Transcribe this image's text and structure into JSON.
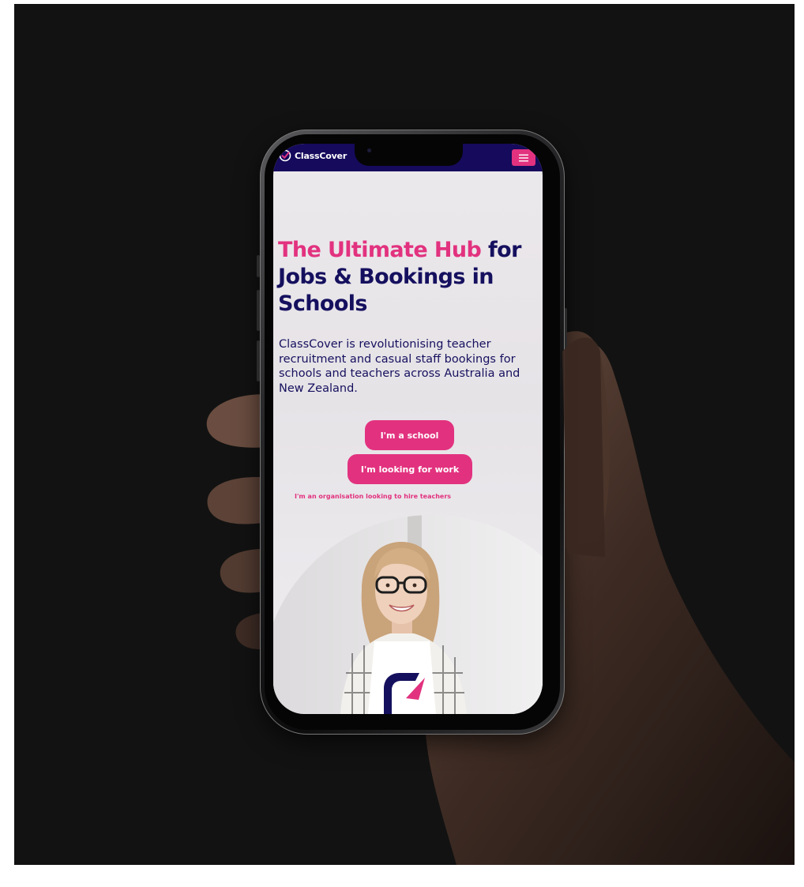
{
  "brand": {
    "logo_text": "ClassCover",
    "navy": "#150a5c",
    "pink": "#e2327f",
    "text_navy": "#15105e"
  },
  "nav": {
    "menu_icon": "hamburger-menu-icon"
  },
  "hero": {
    "headline_accent": "The Ultimate Hub",
    "headline_rest": " for Jobs & Bookings in Schools",
    "intro": "ClassCover is revolutionising teacher recruitment and casual staff bookings for schools and teachers across Australia and New Zealand."
  },
  "cta": {
    "school_label": "I'm a school",
    "work_label": "I'm looking for work",
    "org_link": "I'm an organisation looking to hire teachers"
  },
  "media": {
    "photo": "smiling-teacher-with-glasses-photo"
  }
}
